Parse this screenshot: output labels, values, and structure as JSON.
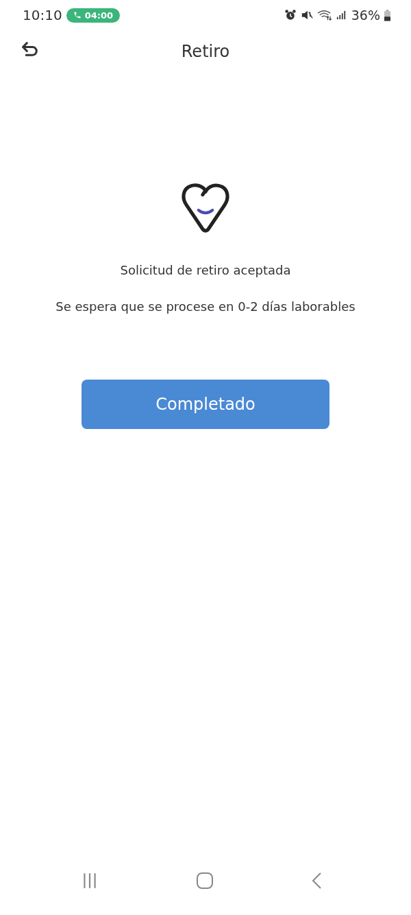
{
  "status_bar": {
    "time": "10:10",
    "call_timer": "04:00",
    "battery": "36%"
  },
  "header": {
    "title": "Retiro"
  },
  "message": {
    "title": "Solicitud de retiro aceptada",
    "subtitle": "Se espera que se procese en 0-2 días laborables"
  },
  "button": {
    "label": "Completado"
  }
}
